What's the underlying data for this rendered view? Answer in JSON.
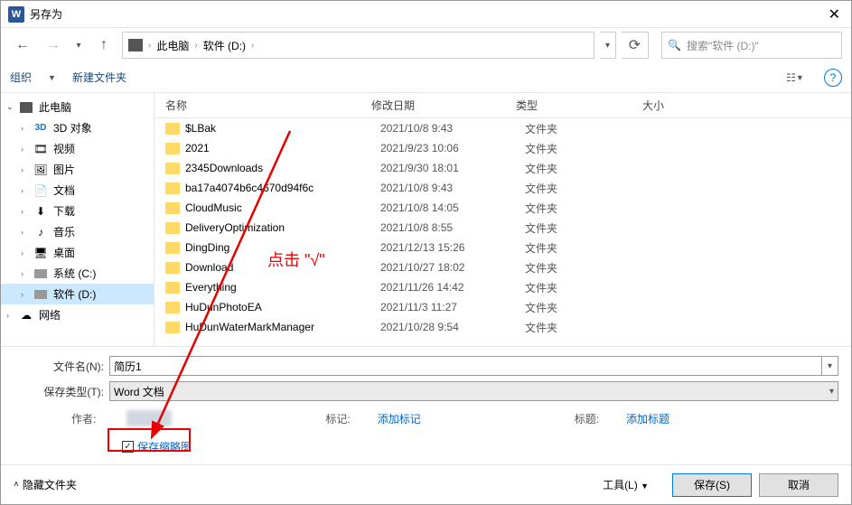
{
  "title": "另存为",
  "breadcrumb": {
    "pc": "此电脑",
    "drive": "软件 (D:)"
  },
  "search_placeholder": "搜索\"软件 (D:)\"",
  "toolbar": {
    "organize": "组织",
    "newfolder": "新建文件夹"
  },
  "sidebar": [
    {
      "label": "此电脑",
      "icon": "pc",
      "expanded": true,
      "depth": 0
    },
    {
      "label": "3D 对象",
      "icon": "3d",
      "depth": 1
    },
    {
      "label": "视频",
      "icon": "video",
      "depth": 1
    },
    {
      "label": "图片",
      "icon": "pic",
      "depth": 1
    },
    {
      "label": "文档",
      "icon": "doc",
      "depth": 1
    },
    {
      "label": "下载",
      "icon": "dl",
      "depth": 1
    },
    {
      "label": "音乐",
      "icon": "music",
      "depth": 1
    },
    {
      "label": "桌面",
      "icon": "desktop",
      "depth": 1
    },
    {
      "label": "系统 (C:)",
      "icon": "drive",
      "depth": 1
    },
    {
      "label": "软件 (D:)",
      "icon": "drive",
      "depth": 1,
      "selected": true
    },
    {
      "label": "网络",
      "icon": "net",
      "depth": 0
    }
  ],
  "columns": {
    "name": "名称",
    "date": "修改日期",
    "type": "类型",
    "size": "大小"
  },
  "files": [
    {
      "name": "$LBak",
      "date": "2021/10/8 9:43",
      "type": "文件夹"
    },
    {
      "name": "2021",
      "date": "2021/9/23 10:06",
      "type": "文件夹"
    },
    {
      "name": "2345Downloads",
      "date": "2021/9/30 18:01",
      "type": "文件夹"
    },
    {
      "name": "ba17a4074b6c4670d94f6c",
      "date": "2021/10/8 9:43",
      "type": "文件夹"
    },
    {
      "name": "CloudMusic",
      "date": "2021/10/8 14:05",
      "type": "文件夹"
    },
    {
      "name": "DeliveryOptimization",
      "date": "2021/10/8 8:55",
      "type": "文件夹"
    },
    {
      "name": "DingDing",
      "date": "2021/12/13 15:26",
      "type": "文件夹"
    },
    {
      "name": "Download",
      "date": "2021/10/27 18:02",
      "type": "文件夹"
    },
    {
      "name": "Everything",
      "date": "2021/11/26 14:42",
      "type": "文件夹"
    },
    {
      "name": "HuDunPhotoEA",
      "date": "2021/11/3 11:27",
      "type": "文件夹"
    },
    {
      "name": "HuDunWaterMarkManager",
      "date": "2021/10/28 9:54",
      "type": "文件夹"
    }
  ],
  "filename_label": "文件名(N):",
  "filename_value": "简历1",
  "filetype_label": "保存类型(T):",
  "filetype_value": "Word 文档",
  "author_label": "作者:",
  "tag_label": "标记:",
  "tag_link": "添加标记",
  "title_label": "标题:",
  "title_link": "添加标题",
  "thumbnail_label": "保存缩略图",
  "hide_folders": "隐藏文件夹",
  "tools_label": "工具(L)",
  "save_label": "保存(S)",
  "cancel_label": "取消",
  "annotation_text": "点击 \"√\""
}
